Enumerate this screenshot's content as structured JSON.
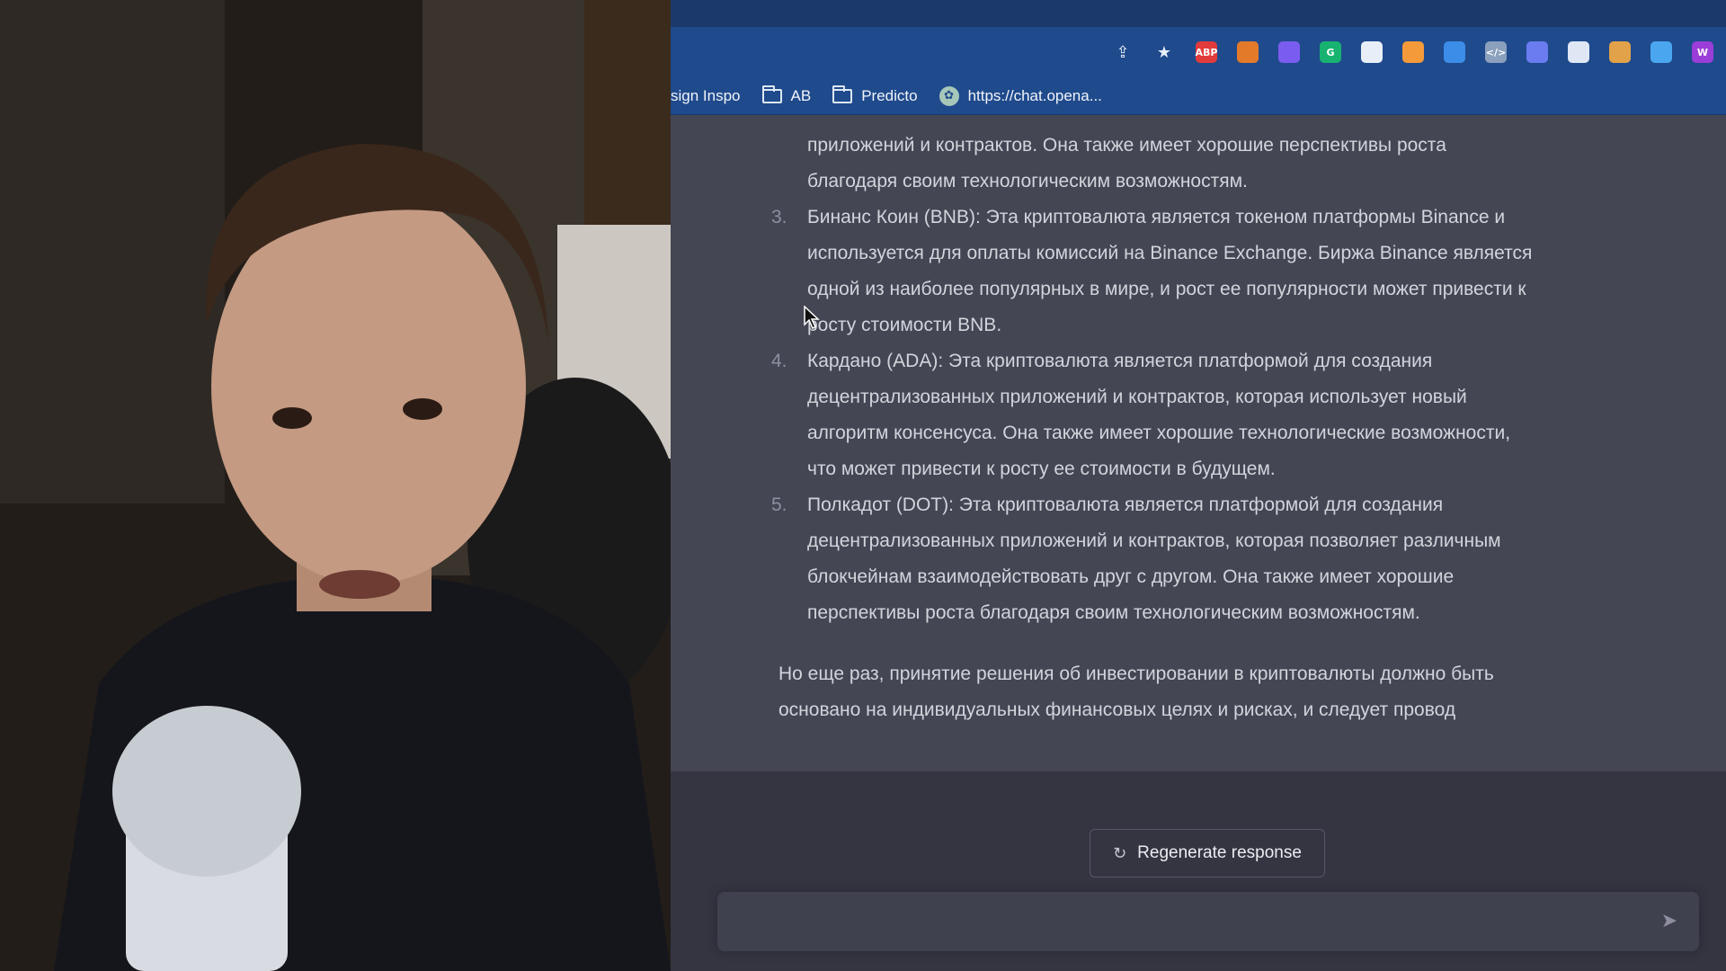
{
  "toolbar": {
    "share_icon": "share-icon",
    "bookmark_icon": "star-icon",
    "extensions": [
      {
        "name": "adblock-icon",
        "text": "ABP",
        "color": "#e23b3b"
      },
      {
        "name": "metamask-icon",
        "text": "",
        "color": "#e27a2a"
      },
      {
        "name": "ghost-extension-icon",
        "text": "",
        "color": "#7b5cf0"
      },
      {
        "name": "grammarly-icon",
        "text": "G",
        "color": "#18b370"
      },
      {
        "name": "lock-extension-icon",
        "text": "",
        "color": "#e8eef8"
      },
      {
        "name": "orb-extension-icon",
        "text": "",
        "color": "#f59a3a"
      },
      {
        "name": "play-extension-icon",
        "text": "",
        "color": "#3b8de8"
      },
      {
        "name": "code-extension-icon",
        "text": "</>",
        "color": "#8aa0bd"
      },
      {
        "name": "gear-extension-icon",
        "text": "",
        "color": "#6a7cf0"
      },
      {
        "name": "page-extension-icon",
        "text": "",
        "color": "#dfe7f5"
      },
      {
        "name": "image-extension-icon",
        "text": "",
        "color": "#e2a24a"
      },
      {
        "name": "edge-extension-icon",
        "text": "",
        "color": "#49a6ef"
      },
      {
        "name": "w-extension-icon",
        "text": "W",
        "color": "#9b3dd8"
      }
    ]
  },
  "bookmarks": [
    {
      "label": "sign Inspo",
      "icon": "none"
    },
    {
      "label": "AB",
      "icon": "folder-icon"
    },
    {
      "label": "Predicto",
      "icon": "folder-icon"
    },
    {
      "label": "https://chat.opena...",
      "icon": "openai-icon"
    }
  ],
  "chat": {
    "lines": [
      "приложений и контрактов. Она также имеет хорошие перспективы роста",
      "благодаря своим технологическим возможностям."
    ],
    "items": [
      {
        "number": "3.",
        "lines": [
          "Бинанс Коин (BNB): Эта криптовалюта является токеном платформы Binance и",
          "используется для оплаты комиссий на Binance Exchange. Биржа Binance является",
          "одной из наиболее популярных в мире, и рост ее популярности может привести к",
          "росту стоимости BNB."
        ]
      },
      {
        "number": "4.",
        "lines": [
          "Кардано (ADA): Эта криптовалюта является платформой для создания",
          "децентрализованных приложений и контрактов, которая использует новый",
          "алгоритм консенсуса. Она также имеет хорошие технологические возможности,",
          "что может привести к росту ее стоимости в будущем."
        ]
      },
      {
        "number": "5.",
        "lines": [
          "Полкадот (DOT): Эта криптовалюта является платформой для создания",
          "децентрализованных приложений и контрактов, которая позволяет различным",
          "блокчейнам взаимодействовать друг с другом. Она также имеет хорошие",
          "перспективы роста благодаря своим технологическим возможностям."
        ]
      }
    ],
    "closing": [
      "Но еще раз, принятие решения об инвестировании в криптовалюты должно быть",
      "основано на индивидуальных финансовых целях и рисках, и следует провод"
    ]
  },
  "regenerate_label": "Regenerate response",
  "prompt_placeholder": ""
}
